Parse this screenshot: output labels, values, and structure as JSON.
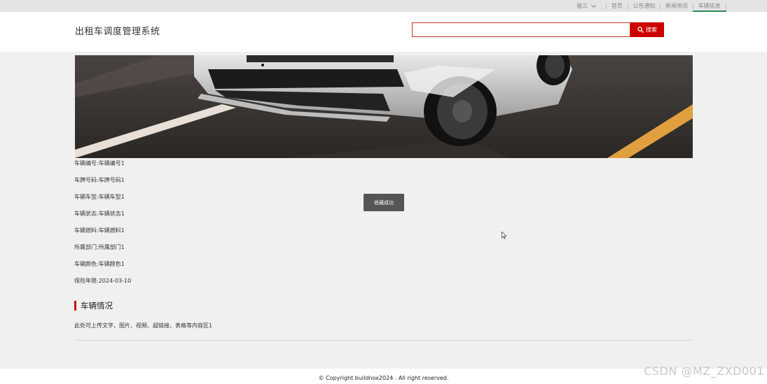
{
  "topbar": {
    "user_name": "张三",
    "nav": [
      {
        "label": "首页"
      },
      {
        "label": "公告通知"
      },
      {
        "label": "新闻资讯"
      },
      {
        "label": "车辆信息",
        "active": true
      }
    ]
  },
  "header": {
    "site_title": "出租车调度管理系统",
    "search_value": "",
    "search_button": "搜索"
  },
  "vehicle": {
    "fields": [
      {
        "label": "车辆编号:车辆编号1"
      },
      {
        "label": "车牌号码:车牌号码1"
      },
      {
        "label": "车辆车型:车辆车型1"
      },
      {
        "label": "车辆状态:车辆状态1"
      },
      {
        "label": "车辆燃料:车辆燃料1"
      },
      {
        "label": "所属部门:所属部门1"
      },
      {
        "label": "车辆颜色:车辆颜色1"
      },
      {
        "label": "保险年限:2024-03-10"
      }
    ]
  },
  "section": {
    "title": "车辆情况",
    "content": "此处可上传文字、图片、视频、超链接、表格等内容区1"
  },
  "toast": {
    "message": "收藏成功"
  },
  "footer": {
    "copyright": "© Copyright buildnox2024 . All right reserved."
  },
  "watermark": "CSDN @MZ_ZXD001",
  "colors": {
    "accent": "#cc0000",
    "nav_active_underline": "#2e8b57",
    "toast_bg": "#555555"
  }
}
